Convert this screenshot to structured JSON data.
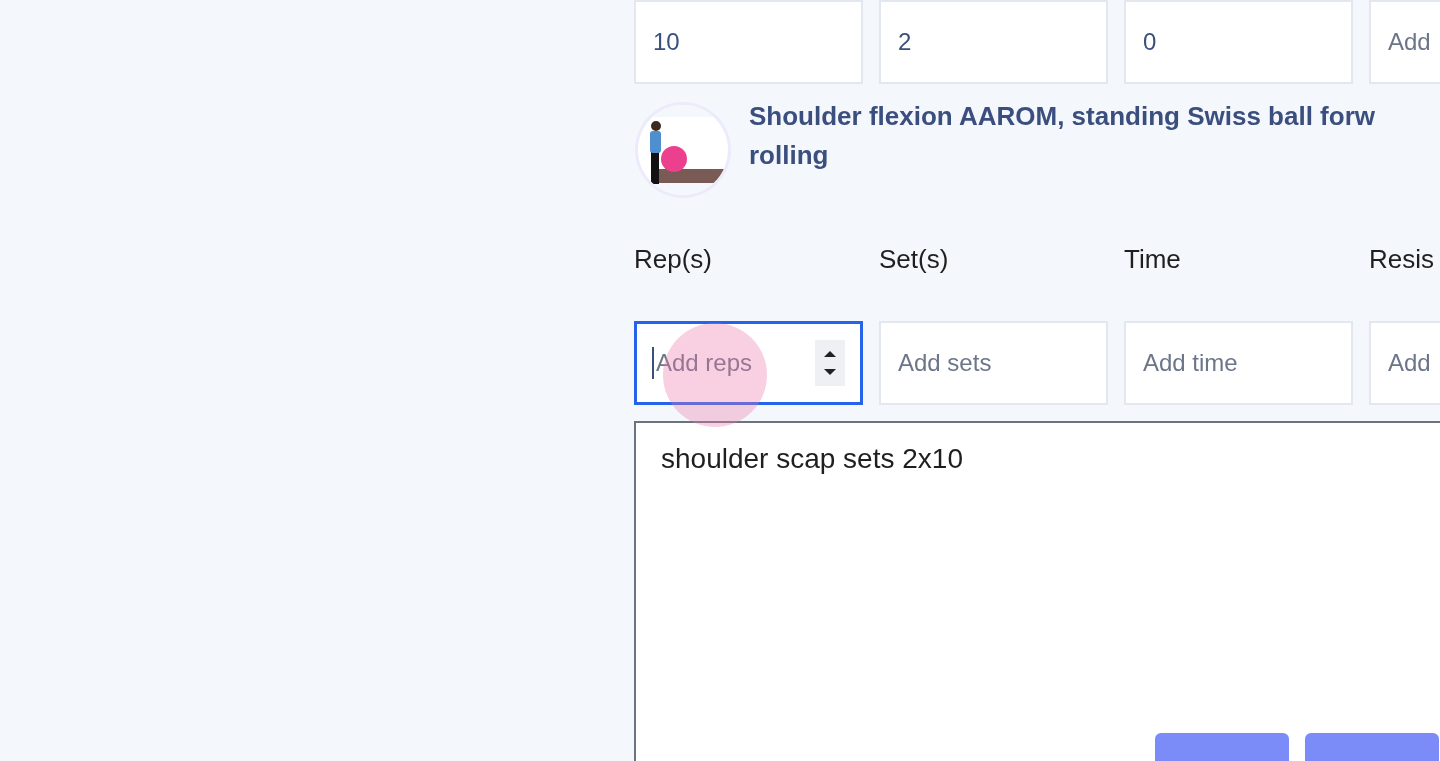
{
  "previous_row": {
    "fields": [
      {
        "value": "10",
        "focused": false
      },
      {
        "value": "2",
        "focused": false
      },
      {
        "value": "0",
        "focused": false
      },
      {
        "placeholder": "Add",
        "focused": false
      }
    ]
  },
  "exercise": {
    "title": "Shoulder flexion AAROM, standing Swiss ball forw\nrolling"
  },
  "columns": [
    "Rep(s)",
    "Set(s)",
    "Time",
    "Resis"
  ],
  "fields": [
    {
      "placeholder": "Add reps",
      "focused": true
    },
    {
      "placeholder": "Add sets",
      "focused": false
    },
    {
      "placeholder": "Add time",
      "focused": false
    },
    {
      "placeholder": "Add",
      "focused": false
    }
  ],
  "notes": {
    "value": "shoulder scap sets 2x10"
  },
  "actions": [
    {
      "kind": "button"
    },
    {
      "kind": "button"
    }
  ]
}
